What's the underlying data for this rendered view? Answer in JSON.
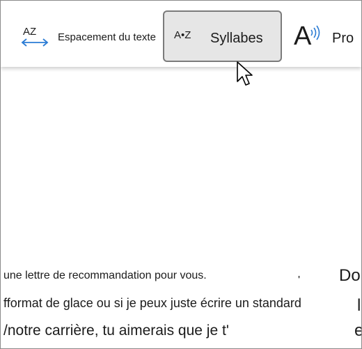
{
  "toolbar": {
    "spacing": {
      "icon_text": "AZ",
      "icon": "text-spacing-icon",
      "label": "Espacement du texte"
    },
    "syllables": {
      "icon_text": "A•Z",
      "icon": "syllables-icon",
      "label": "Syllabes"
    },
    "speech": {
      "icon_text": "A",
      "icon": "speech-icon",
      "label": "Pro"
    }
  },
  "document": {
    "line1": "une lettre de recommandation pour vous.",
    "line2_prefix": "f",
    "line2": "format de glace ou si je peux juste écrire un standard",
    "line3_prefix": "/",
    "line3": "notre carrière, tu aimerais que je t'",
    "right_fragment_1": "Do",
    "right_fragment_2": "l",
    "right_fragment_3": "e",
    "stray_mark": "'"
  },
  "colors": {
    "toolbar_bg": "#ffffff",
    "selected_bg": "#e6e6e6",
    "accent_arrow": "#2a7bd4",
    "text": "#1b1b1b"
  }
}
